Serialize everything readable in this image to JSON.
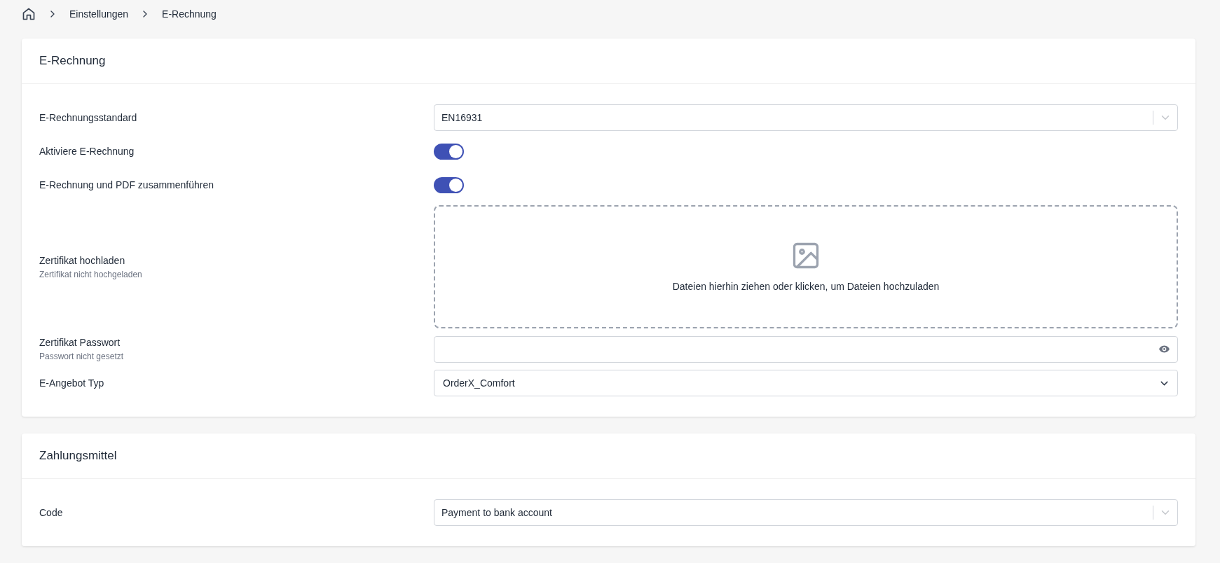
{
  "breadcrumb": [
    {
      "label": "Einstellungen"
    },
    {
      "label": "E-Rechnung"
    }
  ],
  "sections": [
    {
      "title": "E-Rechnung",
      "rows": [
        {
          "kind": "combo",
          "label": "E-Rechnungsstandard",
          "value": "EN16931"
        },
        {
          "kind": "toggle",
          "label": "Aktiviere E-Rechnung",
          "on": true
        },
        {
          "kind": "toggle",
          "label": "E-Rechnung und PDF zusammenführen",
          "on": true
        },
        {
          "kind": "dropzone",
          "label": "Zertifikat hochladen",
          "hint": "Zertifikat nicht hochgeladen",
          "prompt": "Dateien hierhin ziehen oder klicken, um Dateien hochzuladen"
        },
        {
          "kind": "password",
          "label": "Zertifikat Passwort",
          "hint": "Passwort nicht gesetzt"
        },
        {
          "kind": "select",
          "label": "E-Angebot Typ",
          "value": "OrderX_Comfort"
        }
      ]
    },
    {
      "title": "Zahlungsmittel",
      "rows": [
        {
          "kind": "combo",
          "label": "Code",
          "value": "Payment to bank account"
        }
      ]
    }
  ]
}
